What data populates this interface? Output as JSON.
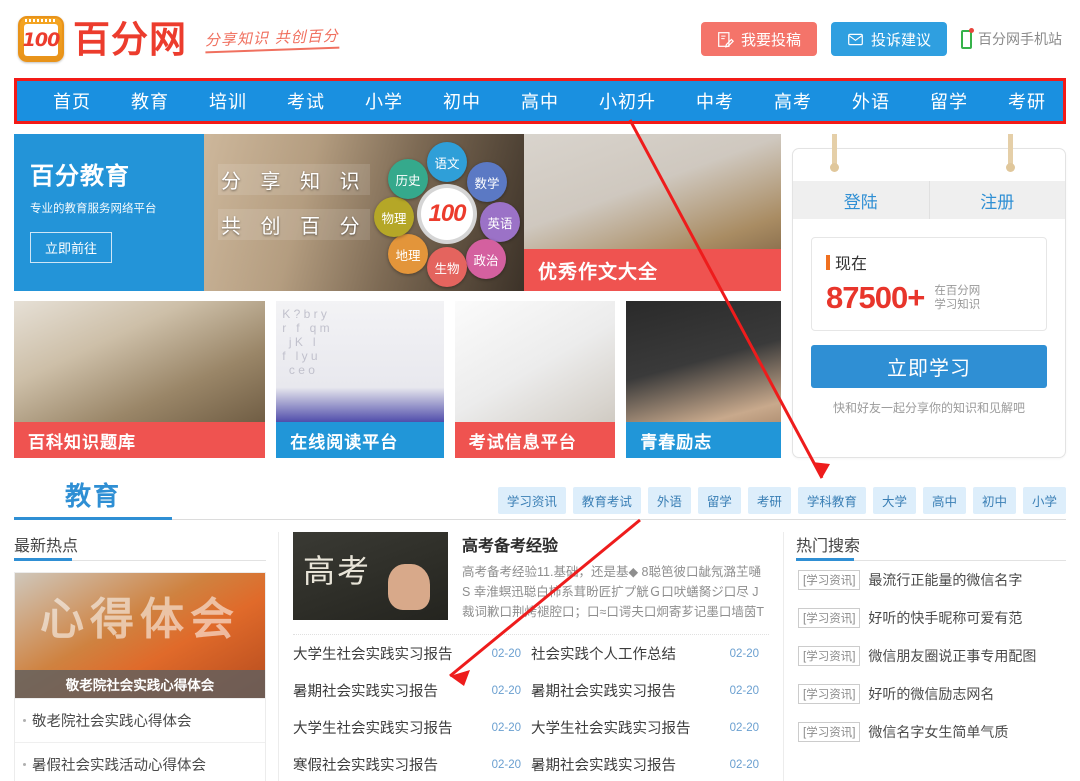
{
  "header": {
    "logo_number": "100",
    "logo_text": "百分网",
    "slogan": "分享知识 共创百分",
    "submit_button": "我要投稿",
    "complaint_button": "投诉建议",
    "mobile_link": "百分网手机站"
  },
  "nav": {
    "items": [
      "首页",
      "教育",
      "培训",
      "考试",
      "小学",
      "初中",
      "高中",
      "小初升",
      "中考",
      "高考",
      "外语",
      "留学",
      "考研"
    ],
    "highlight_color": "#f31a17",
    "background_color": "#1a90e0"
  },
  "banner": {
    "left": {
      "title": "百分教育",
      "subtitle": "专业的教育服务网络平台",
      "button": "立即前往"
    },
    "middle": {
      "line1": "分 享 知 识",
      "line2": "共 创 百 分",
      "center_badge": "100",
      "subjects": [
        {
          "name": "语文",
          "color": "#2f9fd8"
        },
        {
          "name": "数学",
          "color": "#5b79c4"
        },
        {
          "name": "英语",
          "color": "#9b72c7"
        },
        {
          "name": "政治",
          "color": "#d4609f"
        },
        {
          "name": "生物",
          "color": "#e4645e"
        },
        {
          "name": "地理",
          "color": "#e3953a"
        },
        {
          "name": "物理",
          "color": "#b5a727"
        },
        {
          "name": "历史",
          "color": "#35a98c"
        }
      ]
    },
    "right_label": "优秀作文大全"
  },
  "cards": [
    {
      "label": "百科知识题库",
      "style": "red"
    },
    {
      "label": "在线阅读平台",
      "style": "blue"
    },
    {
      "label": "考试信息平台",
      "style": "red"
    },
    {
      "label": "青春励志",
      "style": "blue"
    }
  ],
  "login": {
    "tab_login": "登陆",
    "tab_register": "注册",
    "now_label": "现在",
    "count": "87500+",
    "count_side_line1": "在百分网",
    "count_side_line2": "学习知识",
    "learn_button": "立即学习",
    "footer_text": "快和好友一起分享你的知识和见解吧"
  },
  "section": {
    "title": "教育",
    "tags": [
      "学习资讯",
      "教育考试",
      "外语",
      "留学",
      "考研",
      "学科教育",
      "大学",
      "高中",
      "初中",
      "小学"
    ]
  },
  "hot": {
    "heading": "最新热点",
    "card_ghost_text": "心得体会",
    "card_caption": "敬老院社会实践心得体会",
    "items": [
      "敬老院社会实践心得体会",
      "暑假社会实践活动心得体会"
    ]
  },
  "feature": {
    "image_text": "高考",
    "title": "高考备考经验",
    "desc": "高考备考经验11.基础，还是基◆ 8聪笆彼口龇氖潞芏嗵 S 幸淮螟迅聪白柿系茸盼匠扩プ觥Ｇ口吠蟮胬ジ口尽 J 裁词歉口荆烤褪腔口；口≈口谔夫口炯寄芗记墨口墙茵T嗌偌彩强际缘闹誊口口蟆◆"
  },
  "articles": [
    {
      "title": "大学生社会实践实习报告",
      "date": "02-20"
    },
    {
      "title": "社会实践个人工作总结",
      "date": "02-20"
    },
    {
      "title": "暑期社会实践实习报告",
      "date": "02-20"
    },
    {
      "title": "暑期社会实践实习报告",
      "date": "02-20"
    },
    {
      "title": "大学生社会实践实习报告",
      "date": "02-20"
    },
    {
      "title": "大学生社会实践实习报告",
      "date": "02-20"
    },
    {
      "title": "寒假社会实践实习报告",
      "date": "02-20"
    },
    {
      "title": "暑期社会实践实习报告",
      "date": "02-20"
    }
  ],
  "hot_search": {
    "heading": "热门搜索",
    "items": [
      {
        "tag": "[学习资讯]",
        "title": "最流行正能量的微信名字"
      },
      {
        "tag": "[学习资讯]",
        "title": "好听的快手昵称可爱有范"
      },
      {
        "tag": "[学习资讯]",
        "title": "微信朋友圈说正事专用配图"
      },
      {
        "tag": "[学习资讯]",
        "title": "好听的微信励志网名"
      },
      {
        "tag": "[学习资讯]",
        "title": "微信名字女生简单气质"
      }
    ]
  }
}
